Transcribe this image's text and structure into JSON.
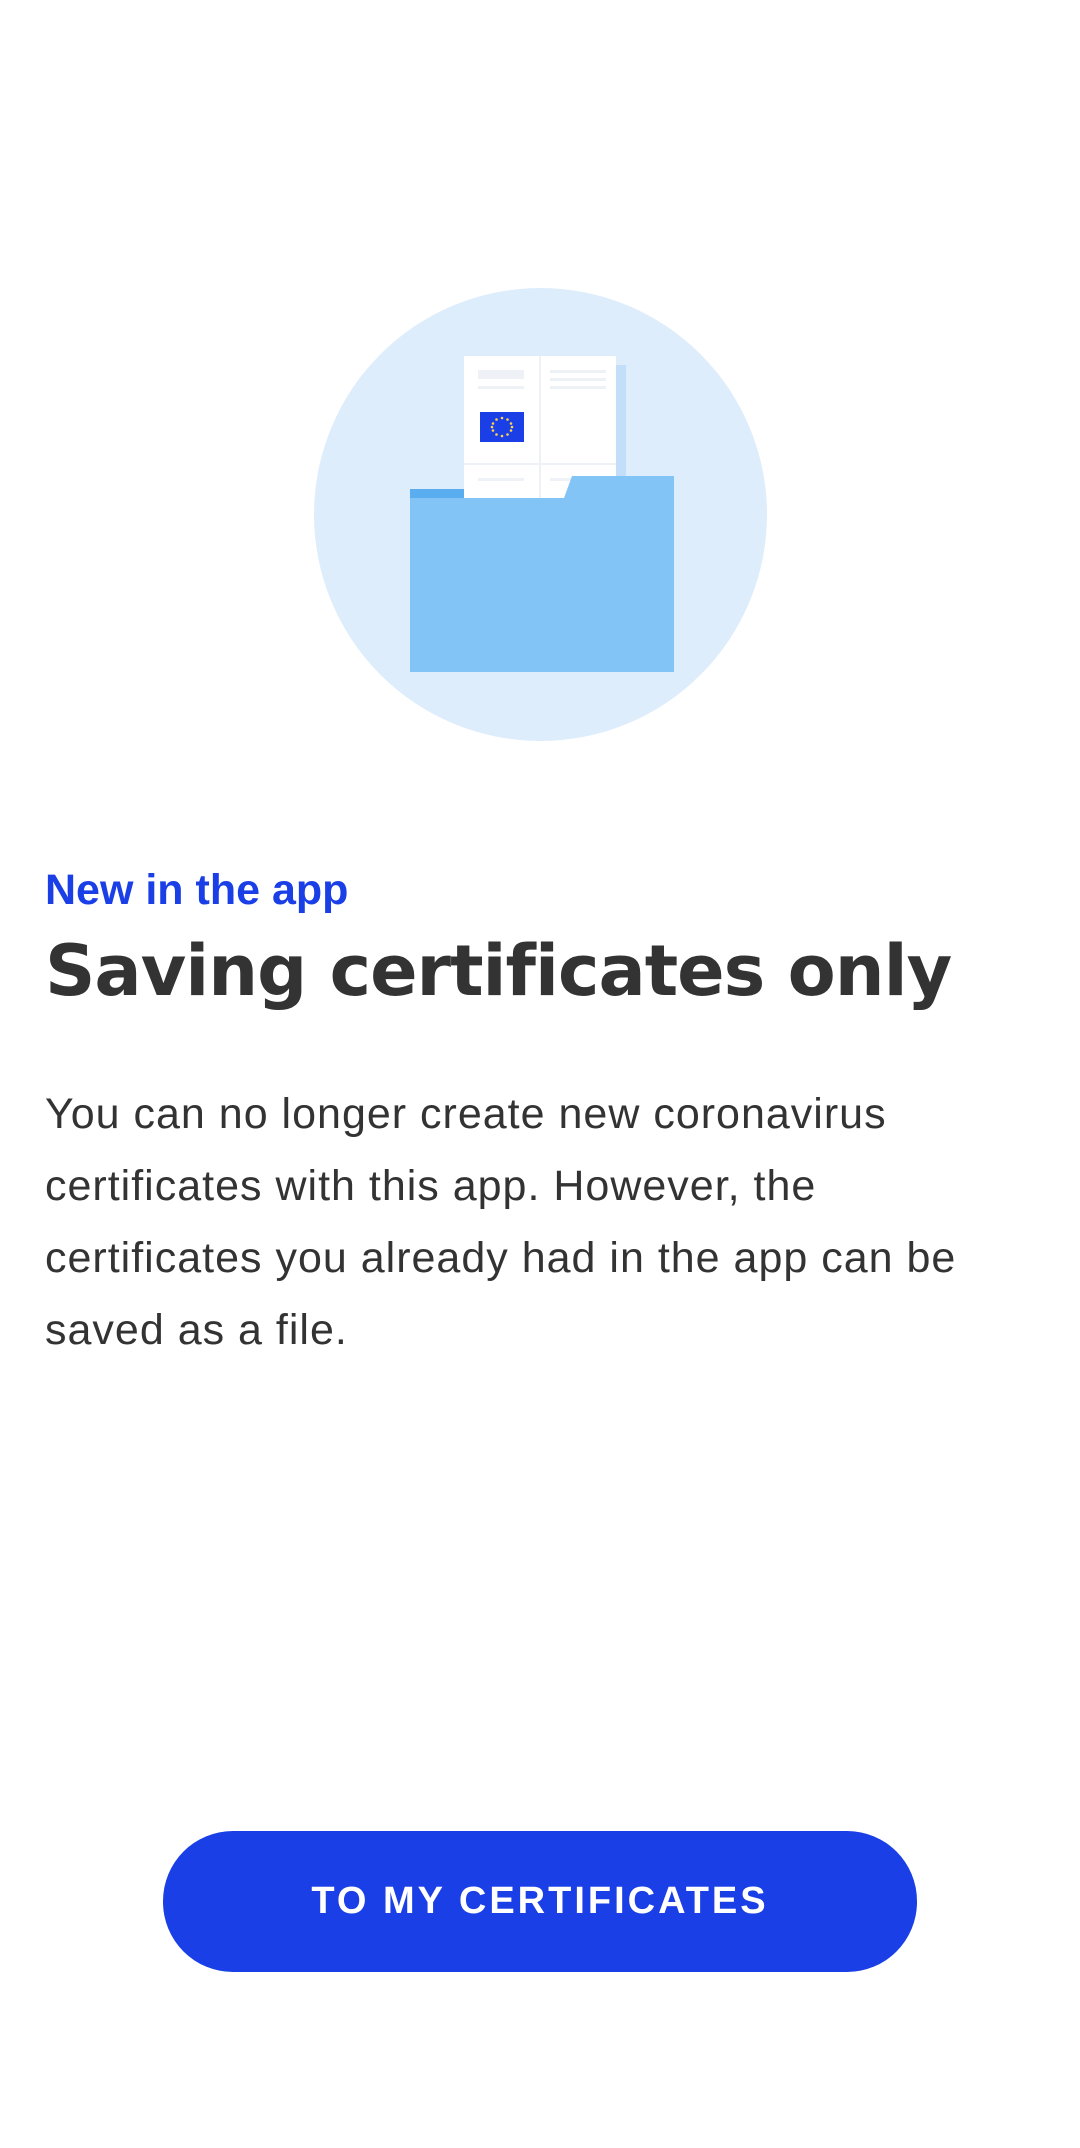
{
  "illustration": {
    "icon": "certificate-folder-icon",
    "colors": {
      "circle": "#deedfc",
      "folder": "#83c4f7",
      "folder_tab": "#5aaef0",
      "document": "#ffffff",
      "eu_flag": "#1a3fe6"
    }
  },
  "kicker": "New in the app",
  "title": "Saving certificates only",
  "body": "You can no longer create new coronavirus certificates with this app. However, the certificates you already had in the app can be saved as a file.",
  "button": {
    "label": "TO MY CERTIFICATES"
  },
  "colors": {
    "accent": "#1a3fe6",
    "text": "#333333",
    "background": "#ffffff"
  }
}
